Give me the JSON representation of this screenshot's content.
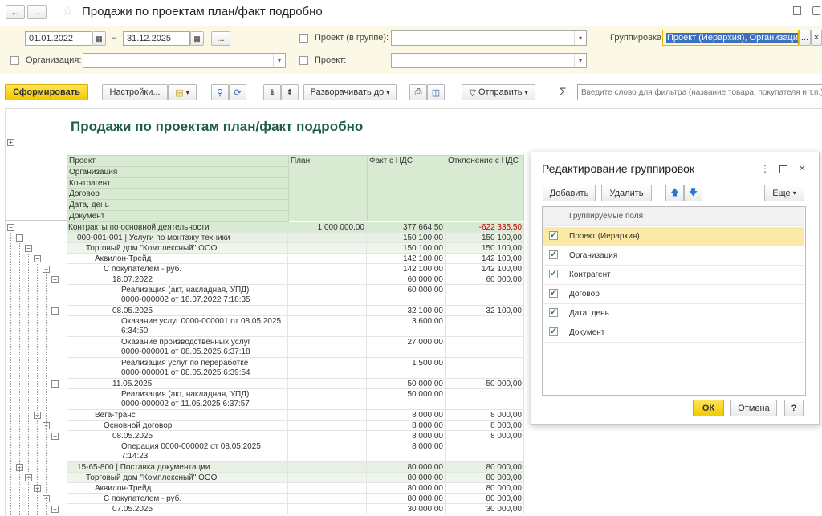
{
  "window": {
    "title": "Продажи по проектам план/факт подробно"
  },
  "filters": {
    "date_from": "01.01.2022",
    "date_to": "31.12.2025",
    "dash": "–",
    "more": "...",
    "org_label": "Организация:",
    "org_value": "",
    "project_group_label": "Проект (в группе):",
    "project_group_value": "",
    "project_label": "Проект:",
    "project_value": "",
    "grouping_label": "Группировка:",
    "grouping_value": "Проект (Иерархия), Организация"
  },
  "toolbar": {
    "generate": "Сформировать",
    "settings": "Настройки...",
    "expand_to": "Разворачивать до",
    "send": "Отправить",
    "sigma": "Σ",
    "search_placeholder": "Введите слово для фильтра (название товара, покупателя и т.п.)"
  },
  "report": {
    "title": "Продажи по проектам план/факт подробно",
    "group_headers": [
      "Проект",
      "Организация",
      "Контрагент",
      "Договор",
      "Дата, день",
      "Документ"
    ],
    "col_plan": "План",
    "col_fact": "Факт с НДС",
    "col_dev": "Отклонение с НДС",
    "rows": [
      {
        "label": "Контракты по основной деятельности",
        "plan": "1 000 000,00",
        "fact": "377 664,50",
        "dev": "-622 335,50",
        "indent": 0,
        "lvl": 0,
        "h": 13
      },
      {
        "label": "000-001-001 | Услуги по монтажу техники",
        "plan": "",
        "fact": "150 100,00",
        "dev": "150 100,00",
        "indent": 1,
        "lvl": 1,
        "h": 13
      },
      {
        "label": "Торговый дом \"Комплексный\" ООО",
        "plan": "",
        "fact": "150 100,00",
        "dev": "150 100,00",
        "indent": 2,
        "lvl": 2,
        "h": 13
      },
      {
        "label": "Аквилон-Трейд",
        "plan": "",
        "fact": "142 100,00",
        "dev": "142 100,00",
        "indent": 3,
        "lvl": 3,
        "h": 13
      },
      {
        "label": "С покупателем - руб.",
        "plan": "",
        "fact": "142 100,00",
        "dev": "142 100,00",
        "indent": 4,
        "lvl": 3,
        "h": 13
      },
      {
        "label": "18.07.2022",
        "plan": "",
        "fact": "60 000,00",
        "dev": "60 000,00",
        "indent": 5,
        "lvl": 3,
        "h": 13
      },
      {
        "label": "Реализация (акт, накладная, УПД)\n0000-000002 от 18.07.2022 7:18:35",
        "plan": "",
        "fact": "60 000,00",
        "dev": "",
        "indent": 6,
        "lvl": 3,
        "h": 26
      },
      {
        "label": "08.05.2025",
        "plan": "",
        "fact": "32 100,00",
        "dev": "32 100,00",
        "indent": 5,
        "lvl": 3,
        "h": 13
      },
      {
        "label": "Оказание услуг 0000-000001 от 08.05.2025\n6:34:50",
        "plan": "",
        "fact": "3 600,00",
        "dev": "",
        "indent": 6,
        "lvl": 3,
        "h": 26
      },
      {
        "label": "Оказание производственных услуг\n0000-000001 от 08.05.2025 6:37:18",
        "plan": "",
        "fact": "27 000,00",
        "dev": "",
        "indent": 6,
        "lvl": 3,
        "h": 26
      },
      {
        "label": "Реализация услуг по переработке\n0000-000001 от 08.05.2025 6:39:54",
        "plan": "",
        "fact": "1 500,00",
        "dev": "",
        "indent": 6,
        "lvl": 3,
        "h": 26
      },
      {
        "label": "11.05.2025",
        "plan": "",
        "fact": "50 000,00",
        "dev": "50 000,00",
        "indent": 5,
        "lvl": 3,
        "h": 13
      },
      {
        "label": "Реализация (акт, накладная, УПД)\n0000-000002 от 11.05.2025 6:37:57",
        "plan": "",
        "fact": "50 000,00",
        "dev": "",
        "indent": 6,
        "lvl": 3,
        "h": 26
      },
      {
        "label": "Вега-транс",
        "plan": "",
        "fact": "8 000,00",
        "dev": "8 000,00",
        "indent": 3,
        "lvl": 3,
        "h": 13
      },
      {
        "label": "Основной договор",
        "plan": "",
        "fact": "8 000,00",
        "dev": "8 000,00",
        "indent": 4,
        "lvl": 3,
        "h": 13
      },
      {
        "label": "08.05.2025",
        "plan": "",
        "fact": "8 000,00",
        "dev": "8 000,00",
        "indent": 5,
        "lvl": 3,
        "h": 13
      },
      {
        "label": "Операция 0000-000002 от 08.05.2025\n7:14:23",
        "plan": "",
        "fact": "8 000,00",
        "dev": "",
        "indent": 6,
        "lvl": 3,
        "h": 26
      },
      {
        "label": "15-65-800 | Поставка документации",
        "plan": "",
        "fact": "80 000,00",
        "dev": "80 000,00",
        "indent": 1,
        "lvl": 1,
        "h": 13
      },
      {
        "label": "Торговый дом \"Комплексный\" ООО",
        "plan": "",
        "fact": "80 000,00",
        "dev": "80 000,00",
        "indent": 2,
        "lvl": 2,
        "h": 13
      },
      {
        "label": "Аквилон-Трейд",
        "plan": "",
        "fact": "80 000,00",
        "dev": "80 000,00",
        "indent": 3,
        "lvl": 3,
        "h": 13
      },
      {
        "label": "С покупателем - руб.",
        "plan": "",
        "fact": "80 000,00",
        "dev": "80 000,00",
        "indent": 4,
        "lvl": 3,
        "h": 13
      },
      {
        "label": "07.05.2025",
        "plan": "",
        "fact": "30 000,00",
        "dev": "30 000,00",
        "indent": 5,
        "lvl": 3,
        "h": 13
      }
    ]
  },
  "dialog": {
    "title": "Редактирование группировок",
    "add": "Добавить",
    "delete": "Удалить",
    "more": "Еще",
    "column_header": "Группируемые поля",
    "items": [
      {
        "label": "Проект (Иерархия)",
        "checked": true,
        "selected": true
      },
      {
        "label": "Организация",
        "checked": true,
        "selected": false
      },
      {
        "label": "Контрагент",
        "checked": true,
        "selected": false
      },
      {
        "label": "Договор",
        "checked": true,
        "selected": false
      },
      {
        "label": "Дата, день",
        "checked": true,
        "selected": false
      },
      {
        "label": "Документ",
        "checked": true,
        "selected": false
      }
    ],
    "ok": "ОК",
    "cancel": "Отмена",
    "help": "?"
  },
  "colors": {
    "accent_yellow": "#f5d10d",
    "group_green": "#d9ead3",
    "title_green": "#1f5f3f",
    "negative": "#c00000"
  }
}
